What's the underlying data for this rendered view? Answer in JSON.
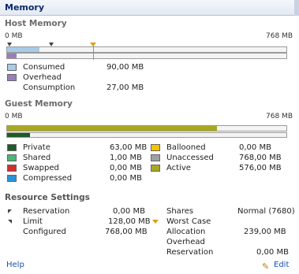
{
  "panel": {
    "title": "Memory"
  },
  "host": {
    "title": "Host Memory",
    "axis_min": "0 MB",
    "axis_max": "768 MB",
    "consumed_fraction": 0.117,
    "overhead_fraction": 0.035,
    "legend": [
      {
        "label": "Consumed",
        "value": "90,00 MB",
        "color": "#a8cbe8"
      },
      {
        "label": "Overhead",
        "value": "",
        "color": "#9a7fb6"
      },
      {
        "label": "Consumption",
        "value": "27,00 MB",
        "color": ""
      }
    ]
  },
  "guest": {
    "title": "Guest Memory",
    "axis_min": "0 MB",
    "axis_max": "768 MB",
    "active_fraction": 0.75,
    "private_fraction": 0.082,
    "legend_left": [
      {
        "label": "Private",
        "value": "63,00 MB",
        "color": "#1f5a2a"
      },
      {
        "label": "Shared",
        "value": "1,00 MB",
        "color": "#4bb57a"
      },
      {
        "label": "Swapped",
        "value": "0,00 MB",
        "color": "#d03030"
      },
      {
        "label": "Compressed",
        "value": "0,00 MB",
        "color": "#2a93d8"
      }
    ],
    "legend_right": [
      {
        "label": "Ballooned",
        "value": "0,00 MB",
        "color": "#f2c200"
      },
      {
        "label": "Unaccessed",
        "value": "768,00 MB",
        "color": "#a0a0a0"
      },
      {
        "label": "Active",
        "value": "576,00 MB",
        "color": "#a8a820"
      }
    ]
  },
  "resources": {
    "title": "Resource Settings",
    "reservation_label": "Reservation",
    "reservation_value": "0,00 MB",
    "limit_label": "Limit",
    "limit_value": "128,00 MB",
    "configured_label": "Configured",
    "configured_value": "768,00 MB",
    "shares_label": "Shares",
    "shares_value": "Normal (7680)",
    "worst_case_label": "Worst Case",
    "allocation_label": "Allocation",
    "allocation_value": "239,00 MB",
    "overhead_label": "Overhead",
    "overhead_reservation_label": "Reservation",
    "overhead_reservation_value": "0,00 MB"
  },
  "footer": {
    "help_label": "Help",
    "edit_label": "Edit"
  }
}
